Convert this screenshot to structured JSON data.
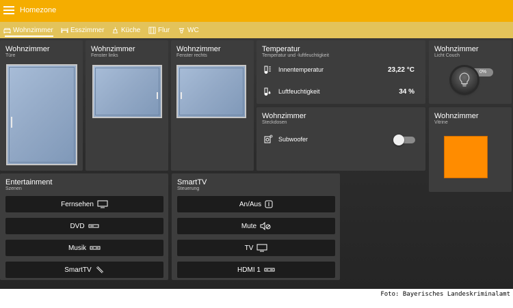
{
  "app": {
    "title": "Homezone",
    "accent": "#f5ad00",
    "tabbar_color": "#e3c35a"
  },
  "tabs": [
    {
      "label": "Wohnzimmer",
      "icon": "sofa-icon",
      "active": true
    },
    {
      "label": "Esszimmer",
      "icon": "dining-table-icon",
      "active": false
    },
    {
      "label": "Küche",
      "icon": "kitchen-icon",
      "active": false
    },
    {
      "label": "Flur",
      "icon": "door-icon",
      "active": false
    },
    {
      "label": "WC",
      "icon": "toilet-icon",
      "active": false
    }
  ],
  "windows": {
    "door": {
      "title": "Wohnzimmer",
      "subtitle": "Türe"
    },
    "left": {
      "title": "Wohnzimmer",
      "subtitle": "Fenster links"
    },
    "right": {
      "title": "Wohnzimmer",
      "subtitle": "Fenster rechts"
    }
  },
  "temperature": {
    "title": "Temperatur",
    "subtitle": "Temperatur und -luftfeuchtigkeit",
    "rows": [
      {
        "label": "Innentemperatur",
        "value": "23,22 °C",
        "icon": "thermometer-icon"
      },
      {
        "label": "Luftfeuchtigkeit",
        "value": "34 %",
        "icon": "humidity-icon"
      }
    ]
  },
  "light": {
    "title": "Wohnzimmer",
    "subtitle": "Licht Couch",
    "value": "0%",
    "level": 0,
    "icon": "light-bulb-icon"
  },
  "socket": {
    "title": "Wohnzimmer",
    "subtitle": "Steckdosen",
    "row_label": "Subwoofer",
    "state": "off",
    "icon": "socket-icon"
  },
  "vitrine": {
    "title": "Wohnzimmer",
    "subtitle": "Vitrine",
    "color": "#ff8c00"
  },
  "entertainment": {
    "title": "Entertainment",
    "subtitle": "Szenen",
    "buttons": [
      {
        "label": "Fernsehen",
        "icon": "tv-icon"
      },
      {
        "label": "DVD",
        "icon": "dvd-player-icon"
      },
      {
        "label": "Musik",
        "icon": "receiver-icon"
      },
      {
        "label": "SmartTV",
        "icon": "remote-control-icon"
      }
    ]
  },
  "smarttv": {
    "title": "SmartTV",
    "subtitle": "Steuerung",
    "buttons": [
      {
        "label": "An/Aus",
        "icon": "power-icon"
      },
      {
        "label": "Mute",
        "icon": "mute-icon"
      },
      {
        "label": "TV",
        "icon": "tv-icon"
      },
      {
        "label": "HDMI 1",
        "icon": "hdmi-icon"
      }
    ]
  },
  "credit": "Foto: Bayerisches Landeskriminalamt"
}
